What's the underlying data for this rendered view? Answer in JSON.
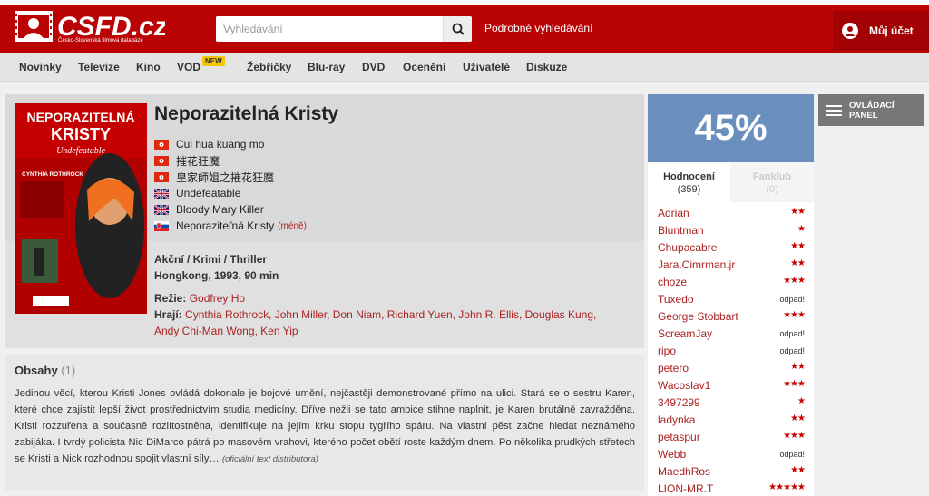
{
  "header": {
    "logo_text": "CSFD.cz",
    "logo_subtitle": "Česko-Slovenská filmová databáze",
    "search_placeholder": "Vyhledávání",
    "advanced_search": "Podrobné vyhledávání",
    "account_label": "Můj účet"
  },
  "nav": {
    "items": [
      "Novinky",
      "Televize",
      "Kino",
      "VOD",
      "Žebříčky",
      "Blu-ray",
      "DVD",
      "Ocenění",
      "Uživatelé",
      "Diskuze"
    ],
    "vod_badge": "NEW"
  },
  "film": {
    "title": "Neporazitelná Kristy",
    "poster_title_line1": "NEPORAZITELNÁ",
    "poster_title_line2": "KRISTY",
    "poster_subtitle": "Undefeatable",
    "poster_actor": "CYNTHIA ROTHROCK",
    "alt_names": [
      {
        "flag": "hongkong",
        "name": "Cui hua kuang mo"
      },
      {
        "flag": "hongkong",
        "name": "摧花狂魔"
      },
      {
        "flag": "hongkong",
        "name": "皇家師姐之摧花狂魔"
      },
      {
        "flag": "uk",
        "name": "Undefeatable"
      },
      {
        "flag": "uk",
        "name": "Bloody Mary Killer"
      },
      {
        "flag": "slovakia",
        "name": "Neporaziteľná Kristy"
      }
    ],
    "less_link": "(méně)",
    "genres": "Akční / Krimi / Thriller",
    "origin": "Hongkong, 1993, 90 min",
    "director_label": "Režie:",
    "director": "Godfrey Ho",
    "cast_label": "Hrají:",
    "cast_line1": "Cynthia Rothrock, John Miller, Don Niam, Richard Yuen, John R. Ellis, Douglas Kung,",
    "cast_line2": "Andy Chi-Man Wong, Ken Yip"
  },
  "plot": {
    "title": "Obsahy",
    "count": "(1)",
    "text": "Jedinou věcí, kterou Kristi Jones ovládá dokonale je bojové umění, nejčastěji demonstrované přímo na ulici. Stará se o sestru Karen, které chce zajistit lepší život prostřednictvím studia medicíny. Dříve nežli se tato ambice stihne naplnit, je Karen brutálně zavražděna. Kristi rozzuřena a současně rozlítostněna, identifikuje na jejím krku stopu tygřího spáru. Na vlastní pěst začne hledat neznámého zabijáka. I tvrdý policista Nic DiMarco pátrá po masovém vrahovi, kterého počet obětí roste každým dnem. Po několika prudkých střetech se Kristi a Nick rozhodnou spojit vlastní síly…",
    "source": "(oficiální text distributora)"
  },
  "rating": {
    "percent": "45%",
    "color": "#6a8fbd",
    "tab_ratings": "Hodnocení",
    "tab_ratings_count": "(359)",
    "tab_fanclub": "Fanklub",
    "tab_fanclub_count": "(0)",
    "users": [
      {
        "name": "Adrian",
        "rating": "★★"
      },
      {
        "name": "Bluntman",
        "rating": "★"
      },
      {
        "name": "Chupacabre",
        "rating": "★★"
      },
      {
        "name": "Jara.Cimrman.jr",
        "rating": "★★"
      },
      {
        "name": "choze",
        "rating": "★★★"
      },
      {
        "name": "Tuxedo",
        "rating": "odpad!"
      },
      {
        "name": "George Stobbart",
        "rating": "★★★"
      },
      {
        "name": "ScreamJay",
        "rating": "odpad!"
      },
      {
        "name": "ripo",
        "rating": "odpad!"
      },
      {
        "name": "petero",
        "rating": "★★"
      },
      {
        "name": "Wacoslav1",
        "rating": "★★★"
      },
      {
        "name": "3497299",
        "rating": "★"
      },
      {
        "name": "ladynka",
        "rating": "★★"
      },
      {
        "name": "petaspur",
        "rating": "★★★"
      },
      {
        "name": "Webb",
        "rating": "odpad!"
      },
      {
        "name": "MaedhRos",
        "rating": "★★"
      },
      {
        "name": "LION-MR.T",
        "rating": "★★★★★"
      }
    ]
  },
  "control_panel": {
    "label": "OVLÁDACÍ PANEL"
  },
  "colors": {
    "brand_red": "#ba0305",
    "link_red": "#aa2222",
    "rating_blue": "#6a8fbd"
  }
}
